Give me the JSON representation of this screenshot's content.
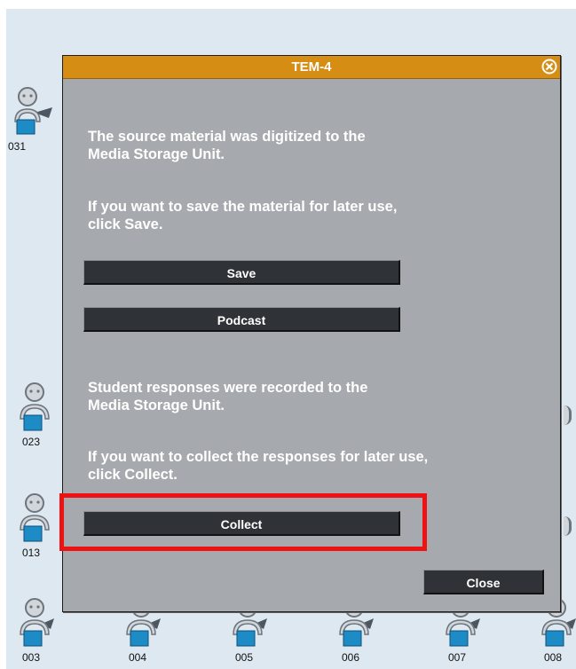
{
  "dialog": {
    "title": "TEM-4",
    "msg_digitized": "The source material was digitized to the\nMedia Storage Unit.",
    "msg_save": "If you want to save the material for later use,\nclick Save.",
    "save_label": "Save",
    "podcast_label": "Podcast",
    "msg_responses": "Student responses were recorded to the\nMedia Storage Unit.",
    "msg_collect": "If you want to collect the responses for later use,\nclick Collect.",
    "collect_label": "Collect",
    "close_label": "Close"
  },
  "seats": {
    "s031": "031",
    "s023": "023",
    "s013": "013",
    "s003": "003",
    "s004": "004",
    "s005": "005",
    "s006": "006",
    "s007": "007",
    "s008": "008"
  },
  "colors": {
    "titlebar": "#d68d14",
    "dialog_bg": "#a6a9ad",
    "button_bg": "#2f3236",
    "highlight": "#ef1212",
    "monitor": "#1d8cc6",
    "canvas_bg": "#dde8f1"
  }
}
